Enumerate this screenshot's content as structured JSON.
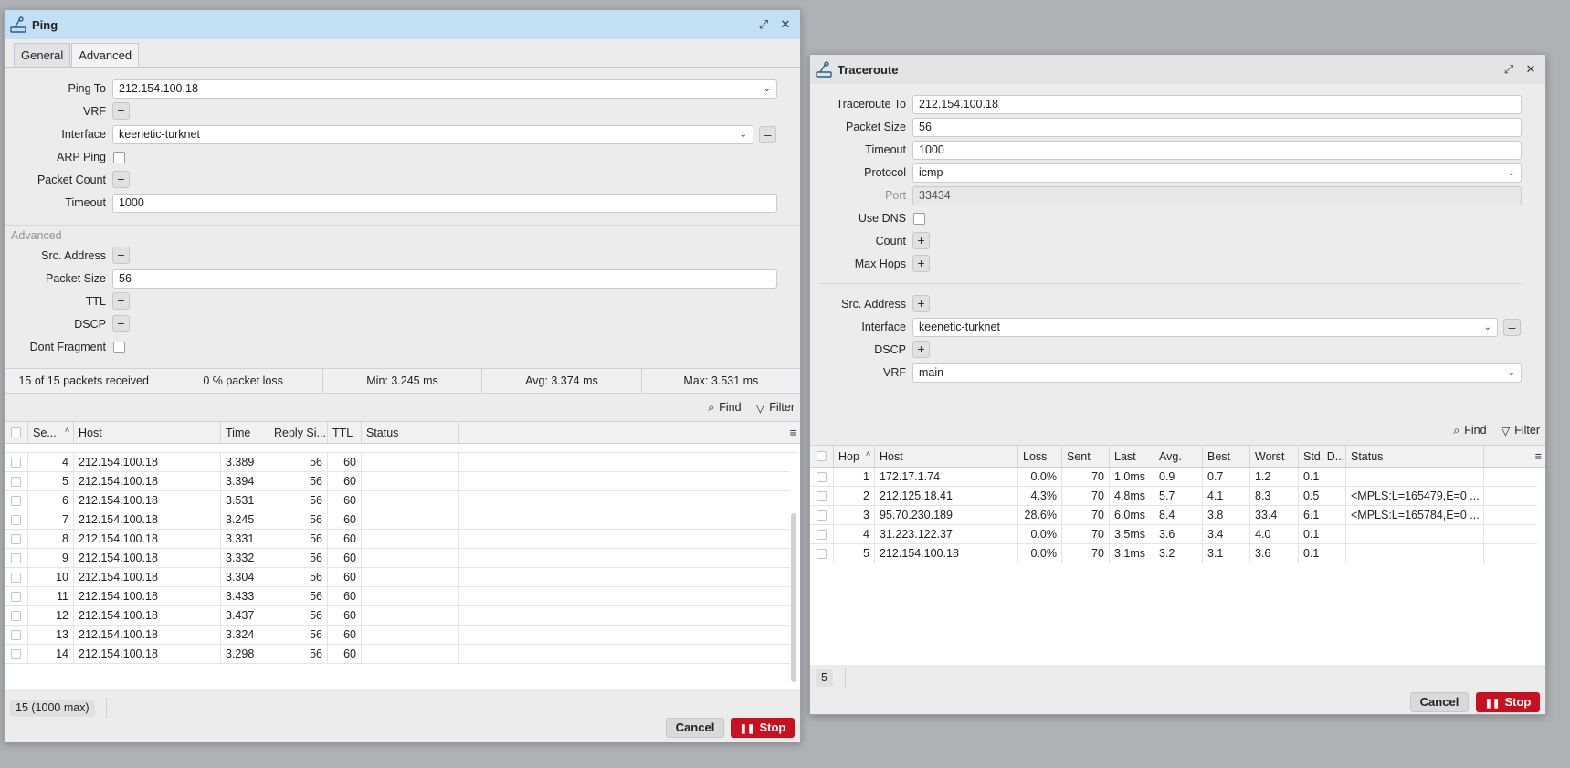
{
  "ping": {
    "title": "Ping",
    "tabs": [
      "General",
      "Advanced"
    ],
    "labels": {
      "ping_to": "Ping To",
      "vrf": "VRF",
      "interface": "Interface",
      "arp_ping": "ARP Ping",
      "packet_count": "Packet Count",
      "timeout": "Timeout",
      "advanced_section": "Advanced",
      "src_address": "Src. Address",
      "packet_size": "Packet Size",
      "ttl": "TTL",
      "dscp": "DSCP",
      "dont_fragment": "Dont Fragment"
    },
    "values": {
      "ping_to": "212.154.100.18",
      "interface": "keenetic-turknet",
      "timeout": "1000",
      "packet_size": "56"
    },
    "stats": {
      "received": "15 of 15 packets received",
      "loss": "0 % packet loss",
      "min": "Min: 3.245 ms",
      "avg": "Avg: 3.374 ms",
      "max": "Max: 3.531 ms"
    },
    "toolbar": {
      "find": "Find",
      "filter": "Filter"
    },
    "columns": [
      "Se...",
      "Host",
      "Time",
      "Reply Si...",
      "TTL",
      "Status"
    ],
    "rows": [
      {
        "seq": "4",
        "host": "212.154.100.18",
        "time": "3.389",
        "size": "56",
        "ttl": "60",
        "status": ""
      },
      {
        "seq": "5",
        "host": "212.154.100.18",
        "time": "3.394",
        "size": "56",
        "ttl": "60",
        "status": ""
      },
      {
        "seq": "6",
        "host": "212.154.100.18",
        "time": "3.531",
        "size": "56",
        "ttl": "60",
        "status": ""
      },
      {
        "seq": "7",
        "host": "212.154.100.18",
        "time": "3.245",
        "size": "56",
        "ttl": "60",
        "status": ""
      },
      {
        "seq": "8",
        "host": "212.154.100.18",
        "time": "3.331",
        "size": "56",
        "ttl": "60",
        "status": ""
      },
      {
        "seq": "9",
        "host": "212.154.100.18",
        "time": "3.332",
        "size": "56",
        "ttl": "60",
        "status": ""
      },
      {
        "seq": "10",
        "host": "212.154.100.18",
        "time": "3.304",
        "size": "56",
        "ttl": "60",
        "status": ""
      },
      {
        "seq": "11",
        "host": "212.154.100.18",
        "time": "3.433",
        "size": "56",
        "ttl": "60",
        "status": ""
      },
      {
        "seq": "12",
        "host": "212.154.100.18",
        "time": "3.437",
        "size": "56",
        "ttl": "60",
        "status": ""
      },
      {
        "seq": "13",
        "host": "212.154.100.18",
        "time": "3.324",
        "size": "56",
        "ttl": "60",
        "status": ""
      },
      {
        "seq": "14",
        "host": "212.154.100.18",
        "time": "3.298",
        "size": "56",
        "ttl": "60",
        "status": ""
      }
    ],
    "count_pill": "15 (1000 max)",
    "cancel": "Cancel",
    "stop": "Stop"
  },
  "traceroute": {
    "title": "Traceroute",
    "labels": {
      "traceroute_to": "Traceroute To",
      "packet_size": "Packet Size",
      "timeout": "Timeout",
      "protocol": "Protocol",
      "port": "Port",
      "use_dns": "Use DNS",
      "count": "Count",
      "max_hops": "Max Hops",
      "src_address": "Src. Address",
      "interface": "Interface",
      "dscp": "DSCP",
      "vrf": "VRF"
    },
    "values": {
      "traceroute_to": "212.154.100.18",
      "packet_size": "56",
      "timeout": "1000",
      "protocol": "icmp",
      "port": "33434",
      "interface": "keenetic-turknet",
      "vrf": "main"
    },
    "toolbar": {
      "find": "Find",
      "filter": "Filter"
    },
    "columns": [
      "Hop",
      "Host",
      "Loss",
      "Sent",
      "Last",
      "Avg.",
      "Best",
      "Worst",
      "Std. D...",
      "Status"
    ],
    "rows": [
      {
        "hop": "1",
        "host": "172.17.1.74",
        "loss": "0.0%",
        "sent": "70",
        "last": "1.0ms",
        "avg": "0.9",
        "best": "0.7",
        "worst": "1.2",
        "std": "0.1",
        "status": ""
      },
      {
        "hop": "2",
        "host": "212.125.18.41",
        "loss": "4.3%",
        "sent": "70",
        "last": "4.8ms",
        "avg": "5.7",
        "best": "4.1",
        "worst": "8.3",
        "std": "0.5",
        "status": "<MPLS:L=165479,E=0 ..."
      },
      {
        "hop": "3",
        "host": "95.70.230.189",
        "loss": "28.6%",
        "sent": "70",
        "last": "6.0ms",
        "avg": "8.4",
        "best": "3.8",
        "worst": "33.4",
        "std": "6.1",
        "status": "<MPLS:L=165784,E=0 ..."
      },
      {
        "hop": "4",
        "host": "31.223.122.37",
        "loss": "0.0%",
        "sent": "70",
        "last": "3.5ms",
        "avg": "3.6",
        "best": "3.4",
        "worst": "4.0",
        "std": "0.1",
        "status": ""
      },
      {
        "hop": "5",
        "host": "212.154.100.18",
        "loss": "0.0%",
        "sent": "70",
        "last": "3.1ms",
        "avg": "3.2",
        "best": "3.1",
        "worst": "3.6",
        "std": "0.1",
        "status": ""
      }
    ],
    "count_pill": "5",
    "cancel": "Cancel",
    "stop": "Stop"
  },
  "colors": {
    "title_active": "#c3dff3",
    "title_inactive": "#e3e4e6",
    "stop": "#c8101e"
  }
}
